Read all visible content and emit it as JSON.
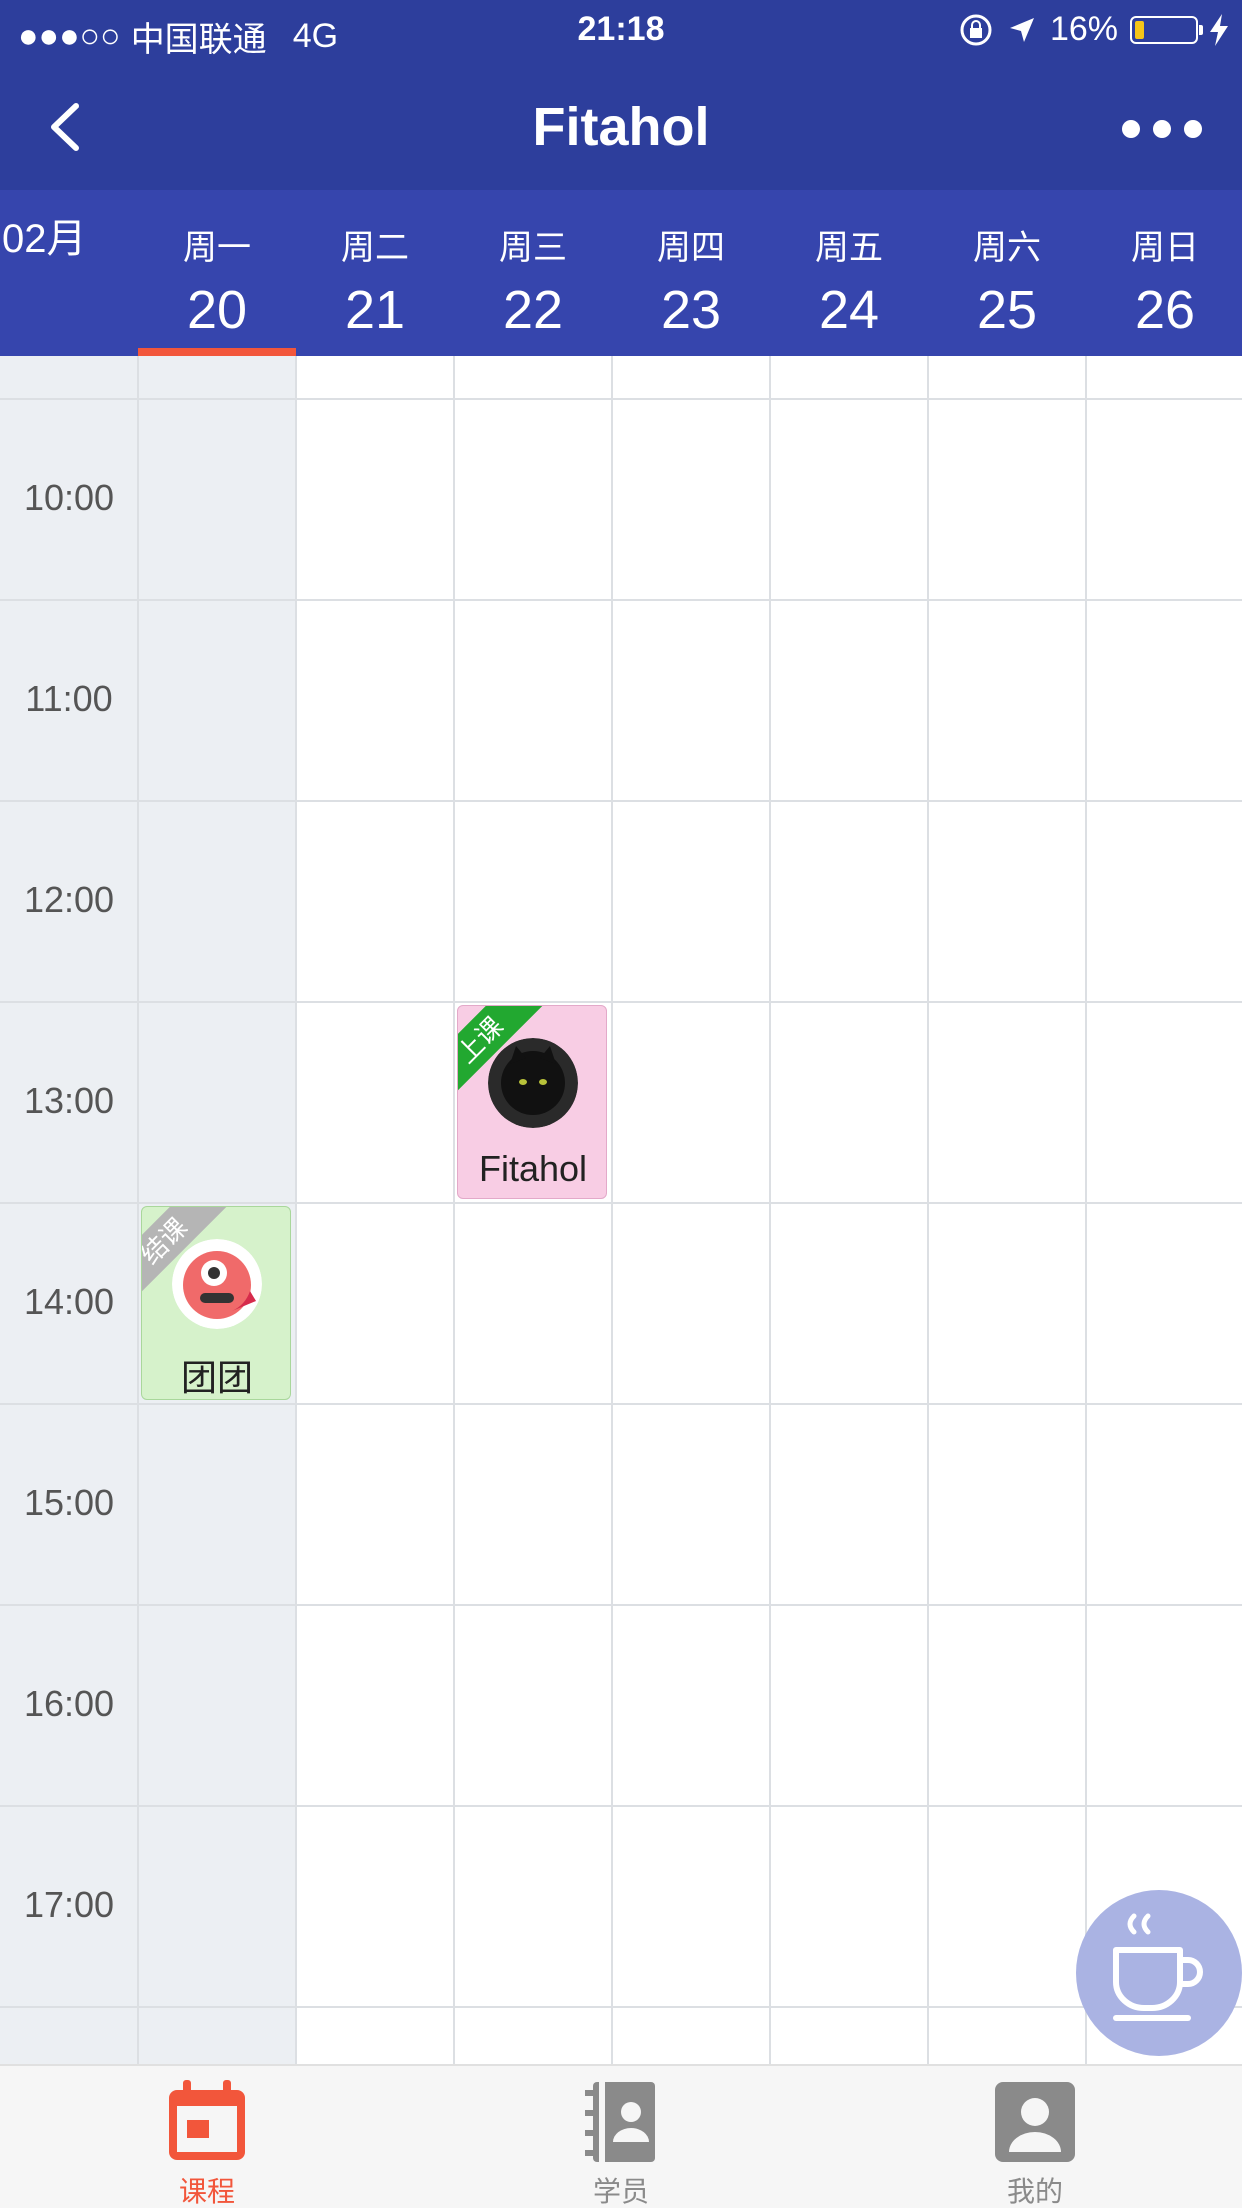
{
  "status_bar": {
    "signal": "●●●○○",
    "carrier": "中国联通",
    "network": "4G",
    "time": "21:18",
    "battery_text": "16%",
    "battery_level": 0.16
  },
  "nav": {
    "title": "Fitahol",
    "back_icon": "chevron-left-icon",
    "more_icon": "more-dots-icon"
  },
  "calendar": {
    "month": "02月",
    "days": [
      {
        "weekday": "周一",
        "date": "20",
        "active": true
      },
      {
        "weekday": "周二",
        "date": "21",
        "active": false
      },
      {
        "weekday": "周三",
        "date": "22",
        "active": false
      },
      {
        "weekday": "周四",
        "date": "23",
        "active": false
      },
      {
        "weekday": "周五",
        "date": "24",
        "active": false
      },
      {
        "weekday": "周六",
        "date": "25",
        "active": false
      },
      {
        "weekday": "周日",
        "date": "26",
        "active": false
      }
    ],
    "times": [
      "10:00",
      "11:00",
      "12:00",
      "13:00",
      "14:00",
      "15:00",
      "16:00",
      "17:00"
    ],
    "courses": [
      {
        "day": "周三",
        "time": "13:00",
        "name": "Fitahol",
        "status": "上课",
        "status_color": "#22a830",
        "bg": "#f8cde4"
      },
      {
        "day": "周一",
        "time": "14:00",
        "name": "团团",
        "status": "结课",
        "status_color": "#b5b5b5",
        "bg": "#d6f2cb"
      }
    ]
  },
  "fab": {
    "icon": "coffee-cup-icon"
  },
  "tabs": [
    {
      "label": "课程",
      "icon": "calendar-icon",
      "active": true
    },
    {
      "label": "学员",
      "icon": "contacts-book-icon",
      "active": false
    },
    {
      "label": "我的",
      "icon": "profile-icon",
      "active": false
    }
  ],
  "colors": {
    "primary": "#2d3e9c",
    "week_header": "#3645ad",
    "accent": "#f2563b",
    "inactive_tab": "#8a8a8a"
  }
}
